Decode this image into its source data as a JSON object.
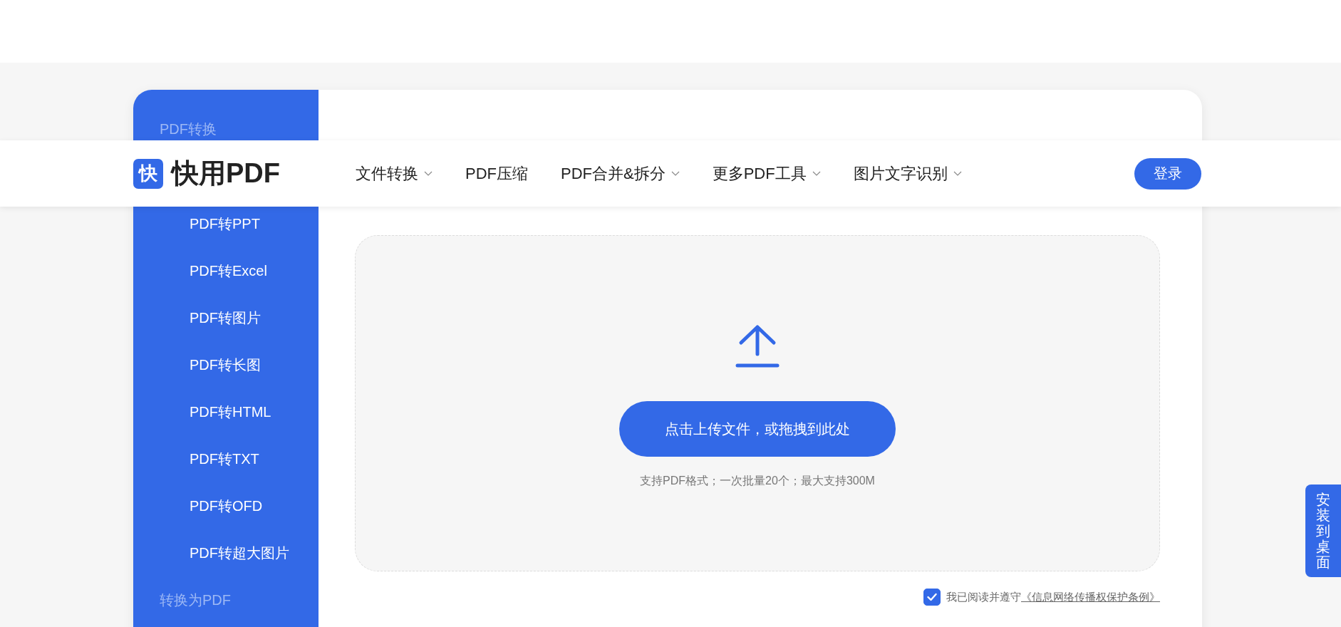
{
  "header": {
    "logo_mark": "快",
    "logo_text": "快用PDF",
    "nav": [
      {
        "label": "文件转换",
        "dropdown": true
      },
      {
        "label": "PDF压缩",
        "dropdown": false
      },
      {
        "label": "PDF合并&拆分",
        "dropdown": true
      },
      {
        "label": "更多PDF工具",
        "dropdown": true
      },
      {
        "label": "图片文字识别",
        "dropdown": true
      }
    ],
    "login": "登录"
  },
  "sidebar": {
    "items": [
      {
        "kind": "category",
        "label": "PDF转换"
      },
      {
        "kind": "item",
        "label": "PDF转PPT"
      },
      {
        "kind": "item",
        "label": "PDF转Excel"
      },
      {
        "kind": "item",
        "label": "PDF转图片"
      },
      {
        "kind": "item",
        "label": "PDF转长图"
      },
      {
        "kind": "item",
        "label": "PDF转HTML"
      },
      {
        "kind": "item",
        "label": "PDF转TXT"
      },
      {
        "kind": "item",
        "label": "PDF转OFD"
      },
      {
        "kind": "item",
        "label": "PDF转超大图片"
      },
      {
        "kind": "category",
        "label": "转换为PDF"
      }
    ]
  },
  "main": {
    "upload": {
      "button": "点击上传文件，或拖拽到此处",
      "hint": "支持PDF格式；一次批量20个；最大支持300M"
    },
    "agreement": {
      "checked": true,
      "text": "我已阅读并遵守",
      "link": "《信息网络传播权保护条例》"
    }
  },
  "side_tab": "安装到桌面"
}
